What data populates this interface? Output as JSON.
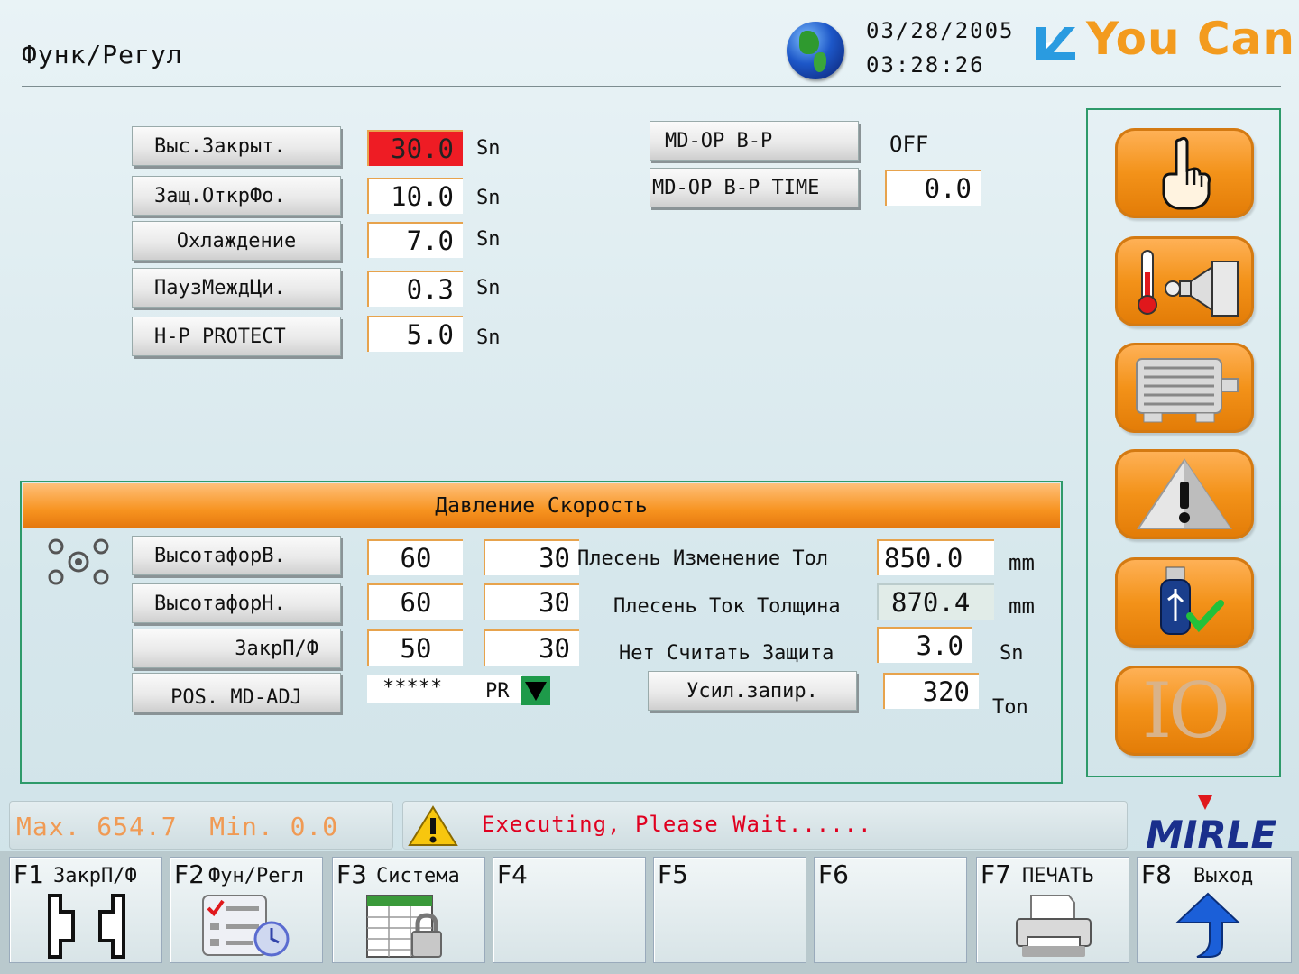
{
  "header": {
    "title": "Функ/Регул",
    "date": "03/28/2005",
    "time": "03:28:26",
    "logo_text": "You Can",
    "logo_color": "#f39b1e"
  },
  "params": [
    {
      "label": "Выс.Закрыт.",
      "value": "30.0",
      "unit": "Sn",
      "highlight": true
    },
    {
      "label": "Защ.ОткрФо.",
      "value": "10.0",
      "unit": "Sn"
    },
    {
      "label": "Охлаждение",
      "value": "7.0",
      "unit": "Sn"
    },
    {
      "label": "ПаузМеждЦи.",
      "value": "0.3",
      "unit": "Sn"
    },
    {
      "label": "H-P PROTECT",
      "value": "5.0",
      "unit": "Sn"
    }
  ],
  "mdop": {
    "bp_label": "MD-OP B-P",
    "bp_value": "OFF",
    "time_label": "MD-OP B-P TIME",
    "time_value": "0.0"
  },
  "section": {
    "title": "Давление Скорость",
    "rows": [
      {
        "label": "ВысотафорВ.",
        "pressure": "60",
        "speed": "30"
      },
      {
        "label": "ВысотафорН.",
        "pressure": "60",
        "speed": "30"
      },
      {
        "label": "ЗакрП/Ф",
        "pressure": "50",
        "speed": "30"
      }
    ],
    "pos_label": "POS. MD-ADJ",
    "pos_value": "*****",
    "pos_mode": "PR",
    "mold_change_label": "Плесень Изменение Тол",
    "mold_change_value": "850.0",
    "mold_change_unit": "mm",
    "mold_current_label": "Плесень Ток Толщина",
    "mold_current_value": "870.4",
    "mold_current_unit": "mm",
    "no_read_label": "Нет Считать Защита",
    "no_read_value": "3.0",
    "no_read_unit": "Sn",
    "force_label": "Усил.запир.",
    "force_value": "320",
    "force_unit": "Ton"
  },
  "sidebar": {
    "icons": [
      "hand-icon",
      "heater-nozzle-icon",
      "motor-icon",
      "alarm-icon",
      "usb-icon",
      "io-icon"
    ],
    "io_text": "IO"
  },
  "status": {
    "max_min": "Max. 654.7  Min. 0.0",
    "message": "Executing, Please Wait......",
    "brand": "MIRLE"
  },
  "fkeys": [
    {
      "key": "F1",
      "label": "ЗакрП/Ф"
    },
    {
      "key": "F2",
      "label": "Фун/Регл"
    },
    {
      "key": "F3",
      "label": "Система"
    },
    {
      "key": "F4",
      "label": ""
    },
    {
      "key": "F5",
      "label": ""
    },
    {
      "key": "F6",
      "label": ""
    },
    {
      "key": "F7",
      "label": "ПЕЧАТЬ"
    },
    {
      "key": "F8",
      "label": "Выход"
    }
  ]
}
